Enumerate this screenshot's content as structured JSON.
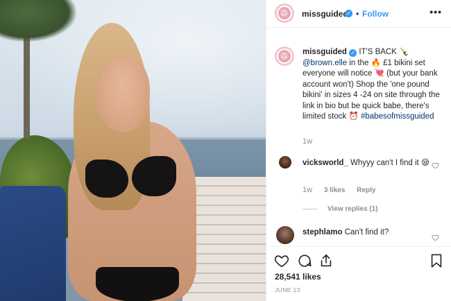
{
  "photo": {
    "alt_icon": "photo-post-image"
  },
  "header": {
    "username": "missguided",
    "verified_icon": "verified-badge-icon",
    "separator": "•",
    "follow_label": "Follow",
    "more_icon": "more-options-icon",
    "more_glyph": "•••"
  },
  "caption": {
    "username": "missguided",
    "segments": {
      "s1": "IT'S BACK 🍾",
      "mention": "@brown.elle",
      "s2": " in the 🔥 £1 bikini set everyone will notice 💘 (but your bank account won't) Shop the 'one pound bikini' in sizes 4 -24 on site through the link in bio but be quick babe, there's limited stock ⏰",
      "hashtag": "#babesofmissguided"
    },
    "time": "1w"
  },
  "comments": [
    {
      "username": "vicksworld_",
      "text": "Whyyy can't I find it 😪",
      "time": "1w",
      "likes": "3 likes",
      "reply_label": "Reply",
      "view_replies": "View replies (1)"
    },
    {
      "username": "stephlamo",
      "text": "Can't find it?"
    }
  ],
  "actions": {
    "likes": "28,541 likes",
    "date": "JUNE 13"
  },
  "colors": {
    "accent": "#3897f0",
    "brand_pink": "#e9a6b1",
    "muted": "#8e8e8e"
  }
}
